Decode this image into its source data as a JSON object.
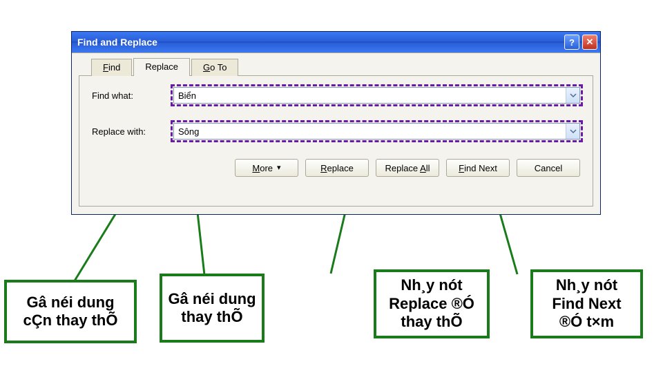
{
  "dialog": {
    "title": "Find and Replace",
    "tabs": {
      "find": "Find",
      "replace": "Replace",
      "goto": "Go To"
    },
    "labels": {
      "find_what": "Find what:",
      "replace_with": "Replace with:"
    },
    "values": {
      "find_what": "Biển",
      "replace_with": "Sông"
    },
    "buttons": {
      "more": "More",
      "replace": "Replace",
      "replace_all": "Replace All",
      "find_next": "Find Next",
      "cancel": "Cancel"
    }
  },
  "annotations": {
    "box1": "Gâ néi dung cÇn thay thÕ",
    "box2": "Gâ néi dung thay thÕ",
    "box3": "Nh¸y nót Replace ®Ó thay thÕ",
    "box4": "Nh¸y nót Find Next ®Ó t×m"
  }
}
